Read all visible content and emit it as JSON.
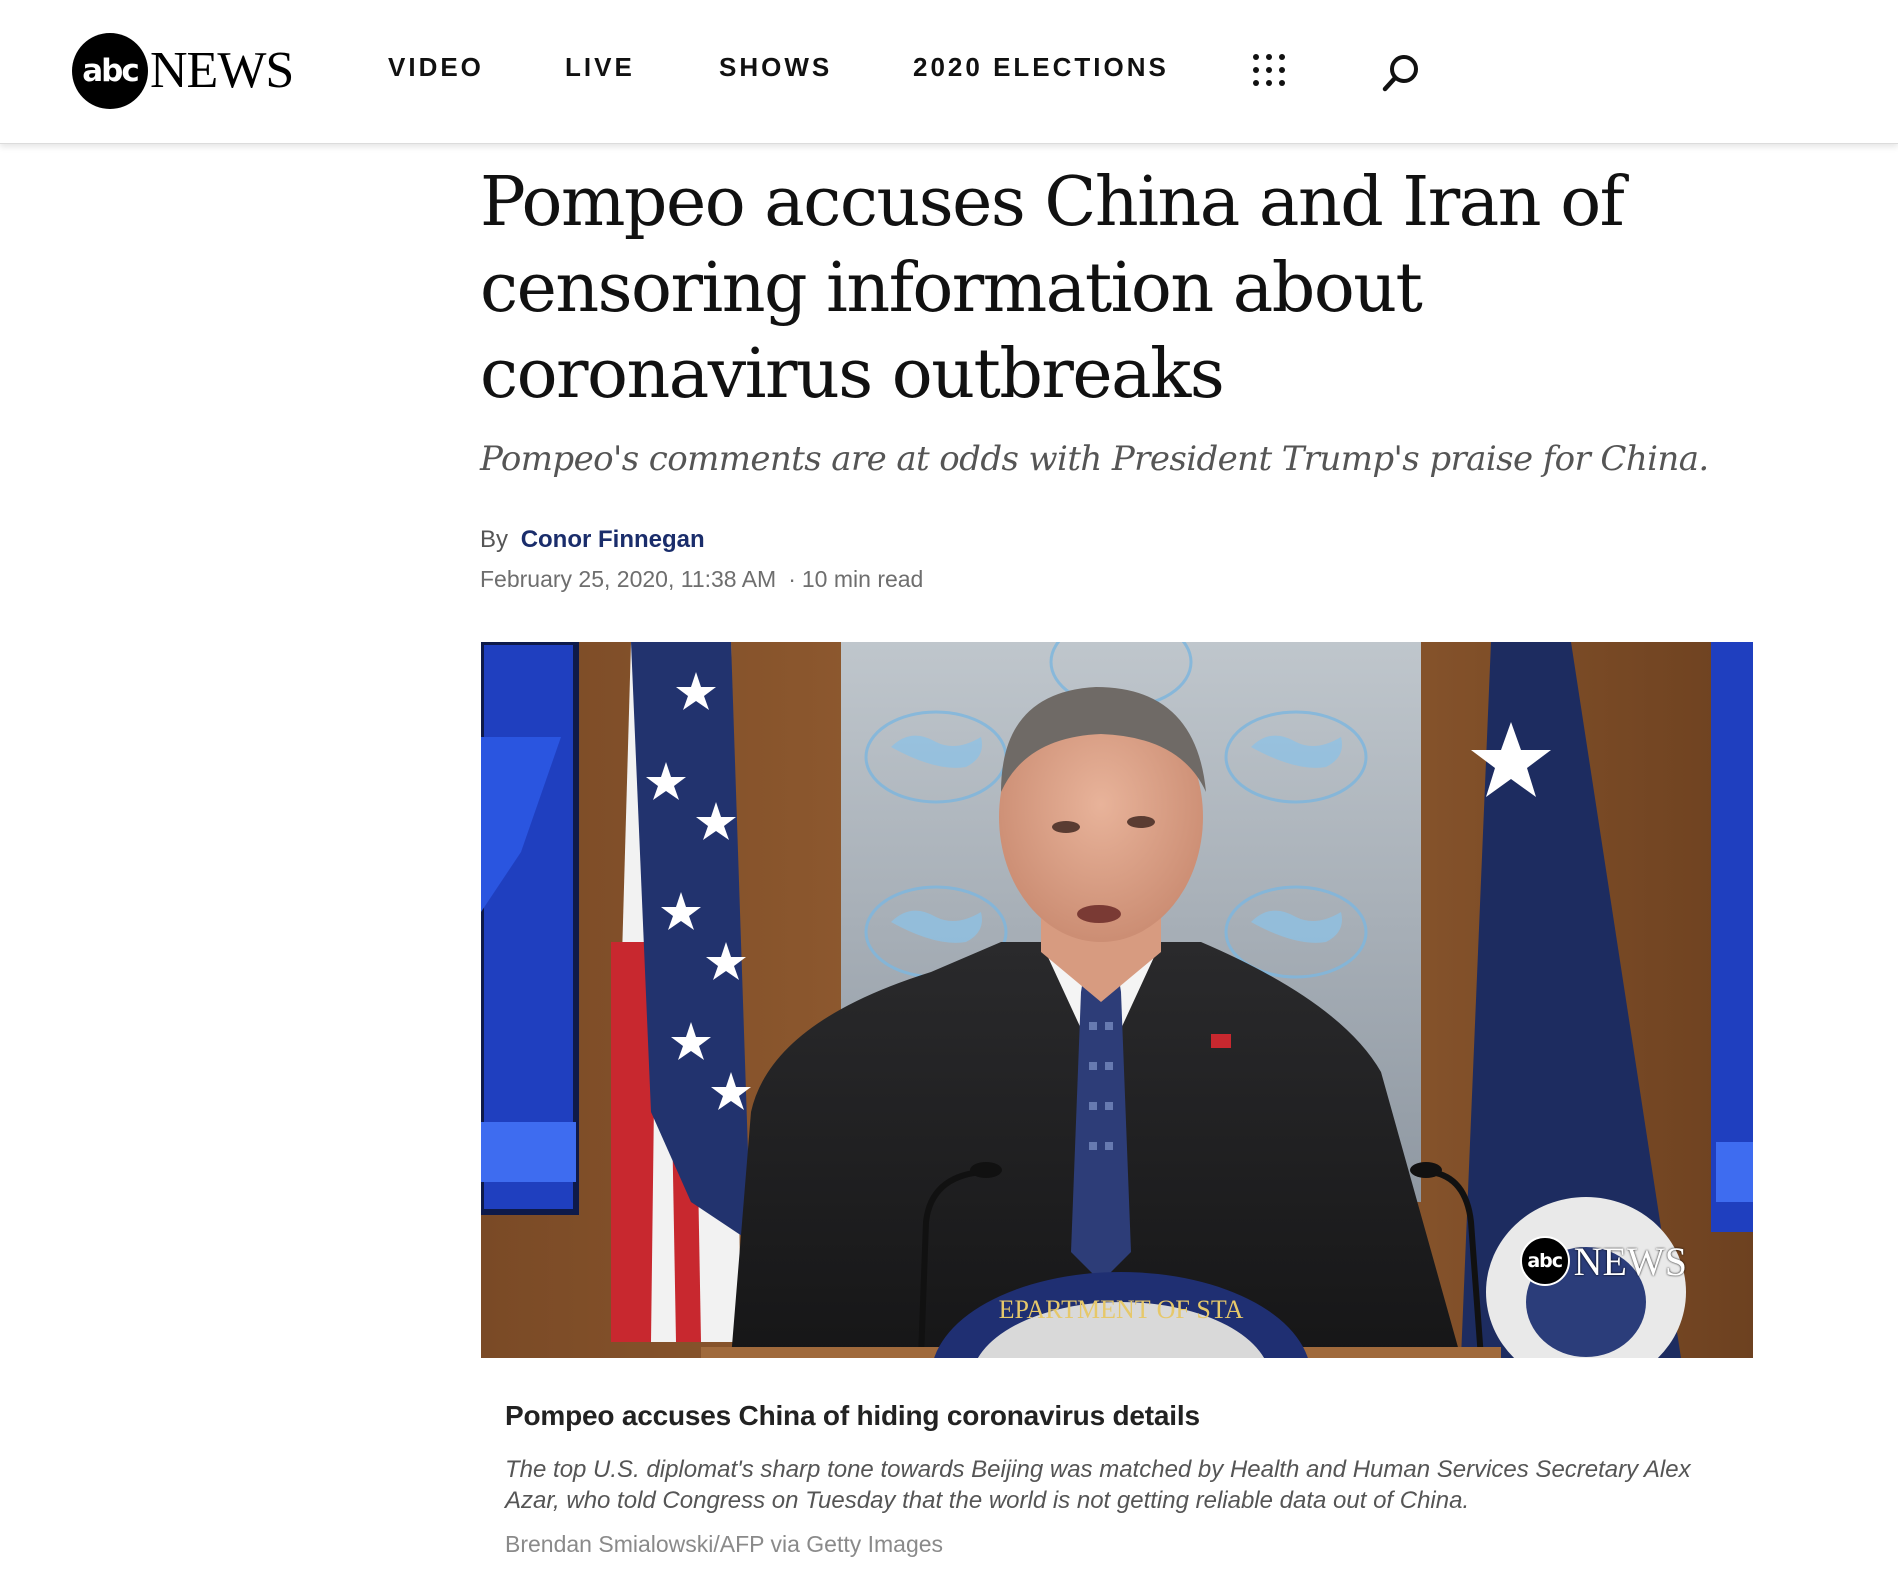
{
  "header": {
    "logo": {
      "mark": "abc",
      "word": "NEWS"
    },
    "nav": [
      {
        "label": "VIDEO"
      },
      {
        "label": "LIVE"
      },
      {
        "label": "SHOWS"
      },
      {
        "label": "2020 ELECTIONS"
      }
    ],
    "icons": {
      "apps": "grid-dots-icon",
      "search": "search-icon"
    }
  },
  "article": {
    "headline": "Pompeo accuses China and Iran of censoring information about coronavirus outbreaks",
    "subhead": "Pompeo's comments are at odds with President Trump's praise for China.",
    "byline_prefix": "By",
    "author": "Conor Finnegan",
    "date": "February 25, 2020, 11:38 AM",
    "read_time": "10 min read",
    "media": {
      "watermark_mark": "abc",
      "watermark_word": "NEWS",
      "seal_text": "EPARTMENT OF STA",
      "caption_title": "Pompeo accuses China of hiding coronavirus details",
      "caption_text": "The top U.S. diplomat's sharp tone towards Beijing was matched by Health and Human Services Secretary Alex Azar, who told Congress on Tuesday that the world is not getting reliable data out of China.",
      "credit": "Brendan Smialowski/AFP via Getty Images"
    }
  },
  "colors": {
    "author_link": "#1a2d6b",
    "headline": "#111111",
    "subhead": "#555555",
    "meta": "#6e6e6e"
  }
}
